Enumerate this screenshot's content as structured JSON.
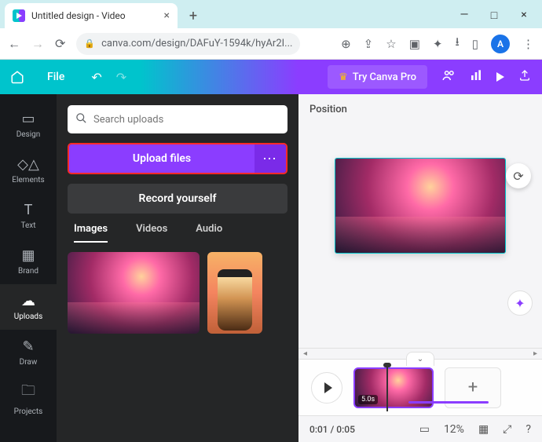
{
  "browser": {
    "tab_title": "Untitled design - Video",
    "url_display": "canva.com/design/DAFuY-1594k/hyAr2I...",
    "avatar_letter": "A"
  },
  "topbar": {
    "file_label": "File",
    "try_pro_label": "Try Canva Pro"
  },
  "rail": {
    "items": [
      {
        "label": "Design",
        "icon": "▭"
      },
      {
        "label": "Elements",
        "icon": "✧"
      },
      {
        "label": "Text",
        "icon": "T"
      },
      {
        "label": "Brand",
        "icon": "▦"
      },
      {
        "label": "Uploads",
        "icon": "☁"
      },
      {
        "label": "Draw",
        "icon": "✎"
      },
      {
        "label": "Projects",
        "icon": "🗀"
      }
    ],
    "active_index": 4
  },
  "panel": {
    "search_placeholder": "Search uploads",
    "upload_label": "Upload files",
    "record_label": "Record yourself",
    "tabs": [
      "Images",
      "Videos",
      "Audio"
    ],
    "active_tab": 0
  },
  "canvas": {
    "position_label": "Position"
  },
  "timeline": {
    "clip_duration": "5.0s"
  },
  "bottombar": {
    "time_display": "0:01 / 0:05",
    "zoom_display": "12%"
  }
}
